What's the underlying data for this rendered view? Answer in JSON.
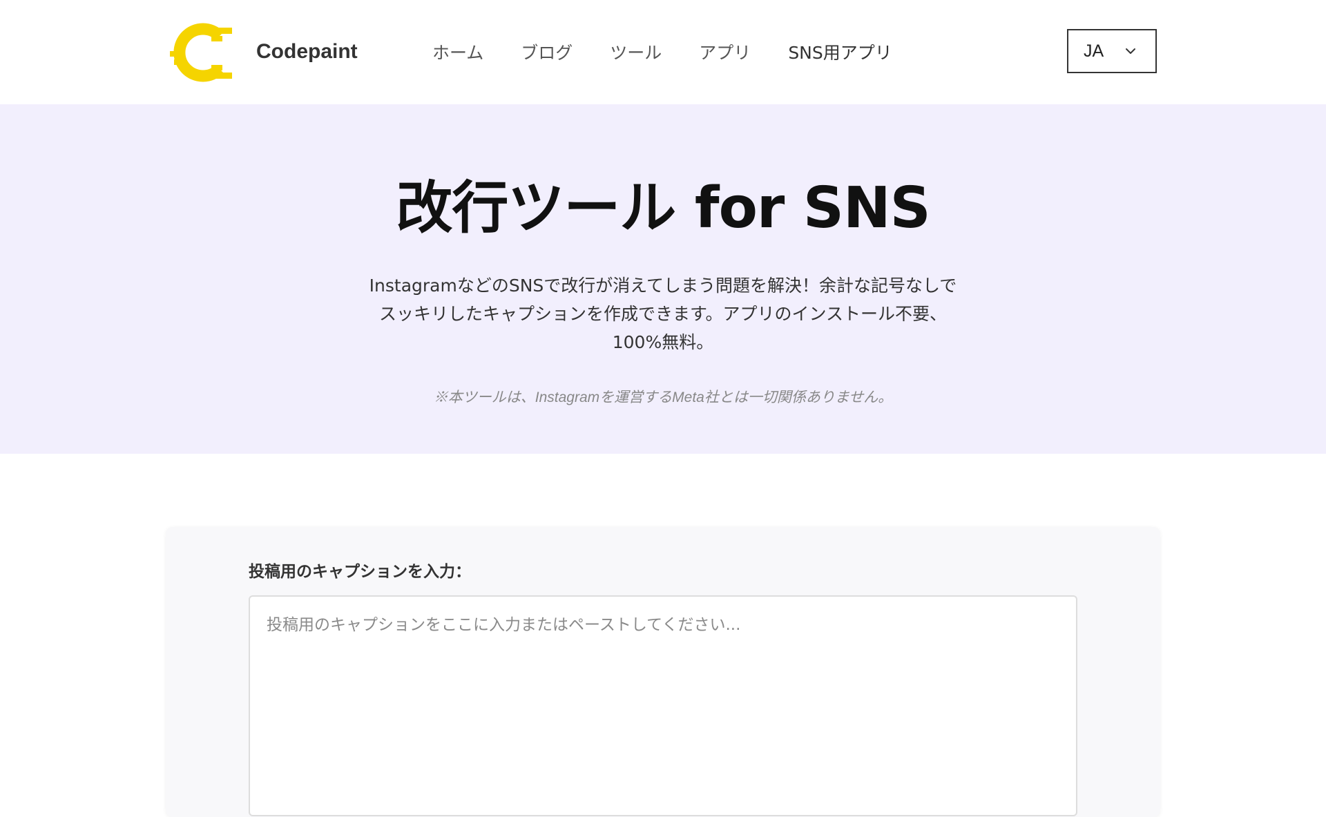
{
  "header": {
    "brand_name": "Codepaint",
    "nav": [
      {
        "label": "ホーム"
      },
      {
        "label": "ブログ"
      },
      {
        "label": "ツール"
      },
      {
        "label": "アプリ"
      },
      {
        "label": "SNS用アプリ"
      }
    ],
    "language": {
      "selected": "JA",
      "icon": "chevron-down-icon"
    },
    "logo_icon": "codepaint-logo",
    "logo_color": "#f5d400"
  },
  "hero": {
    "title": "改行ツール for SNS",
    "description_lines": [
      "InstagramなどのSNSで改行が消えてしまう問題を解決！余計な記号なしで",
      "スッキリしたキャプションを作成できます。アプリのインストール不要、",
      "100%無料。"
    ],
    "note": "※本ツールは、Instagramを運営するMeta社とは一切関係ありません。",
    "background": "#f2effd"
  },
  "editor": {
    "label": "投稿用のキャプションを入力：",
    "placeholder": "投稿用のキャプションをここに入力またはペーストしてください...",
    "value": ""
  }
}
